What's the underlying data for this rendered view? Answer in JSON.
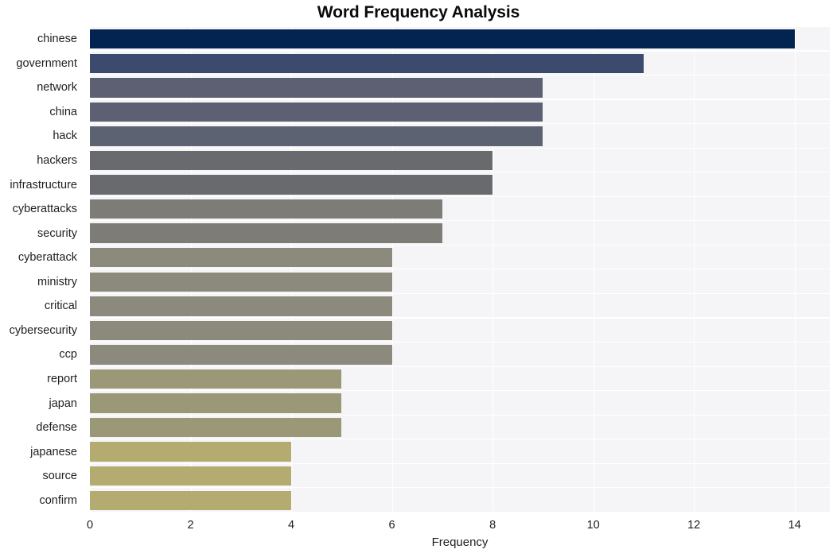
{
  "chart_data": {
    "type": "bar",
    "orientation": "horizontal",
    "title": "Word Frequency Analysis",
    "xlabel": "Frequency",
    "ylabel": "",
    "xlim": [
      0,
      14.7
    ],
    "ylim": null,
    "grid": true,
    "legend": null,
    "xticks": [
      0,
      2,
      4,
      6,
      8,
      10,
      12,
      14
    ],
    "xtick_labels": [
      "0",
      "2",
      "4",
      "6",
      "8",
      "10",
      "12",
      "14"
    ],
    "categories": [
      "chinese",
      "government",
      "network",
      "china",
      "hack",
      "hackers",
      "infrastructure",
      "cyberattacks",
      "security",
      "cyberattack",
      "ministry",
      "critical",
      "cybersecurity",
      "ccp",
      "report",
      "japan",
      "defense",
      "japanese",
      "source",
      "confirm"
    ],
    "values": [
      14,
      11,
      9,
      9,
      9,
      8,
      8,
      7,
      7,
      6,
      6,
      6,
      6,
      6,
      5,
      5,
      5,
      4,
      4,
      4
    ],
    "bar_colors": [
      "#032451",
      "#3b4a6d",
      "#5c6072",
      "#5c6072",
      "#5c6272",
      "#696a6e",
      "#696a6e",
      "#7d7c77",
      "#7d7c77",
      "#8c8a7c",
      "#8c8a7c",
      "#8c8a7c",
      "#8c8a7c",
      "#8c8a7c",
      "#9b9878",
      "#9b9878",
      "#9b9878",
      "#b3ab6f",
      "#b3ab6f",
      "#b3ab6f"
    ],
    "plot_background": "#f5f5f7",
    "gridline_color": "#ffffff",
    "figure_background": "#ffffff",
    "text_color": "#1f1f1f"
  }
}
